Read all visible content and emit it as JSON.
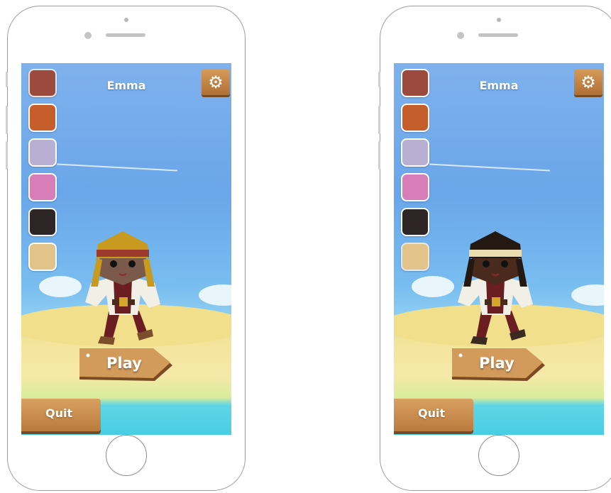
{
  "screens": [
    {
      "player_name": "Emma",
      "play_label": "Play",
      "quit_label": "Quit",
      "settings_icon": "gear-icon",
      "selected_color": "#9c4a3e",
      "skin_tone": "#7a5a4a",
      "hair_color": "#c99a20",
      "palette": [
        "#9c4a3e",
        "#c55e2a",
        "#b8afd2",
        "#d77db8",
        "#2e2626",
        "#e2c48a"
      ]
    },
    {
      "player_name": "Emma",
      "play_label": "Play",
      "quit_label": "Quit",
      "settings_icon": "gear-icon",
      "selected_color": "#e2c48a",
      "skin_tone": "#4a2a1c",
      "hair_color": "#e8dcb0",
      "palette": [
        "#9c4a3e",
        "#c55e2a",
        "#b8afd2",
        "#d77db8",
        "#2e2626",
        "#e2c48a"
      ]
    }
  ]
}
